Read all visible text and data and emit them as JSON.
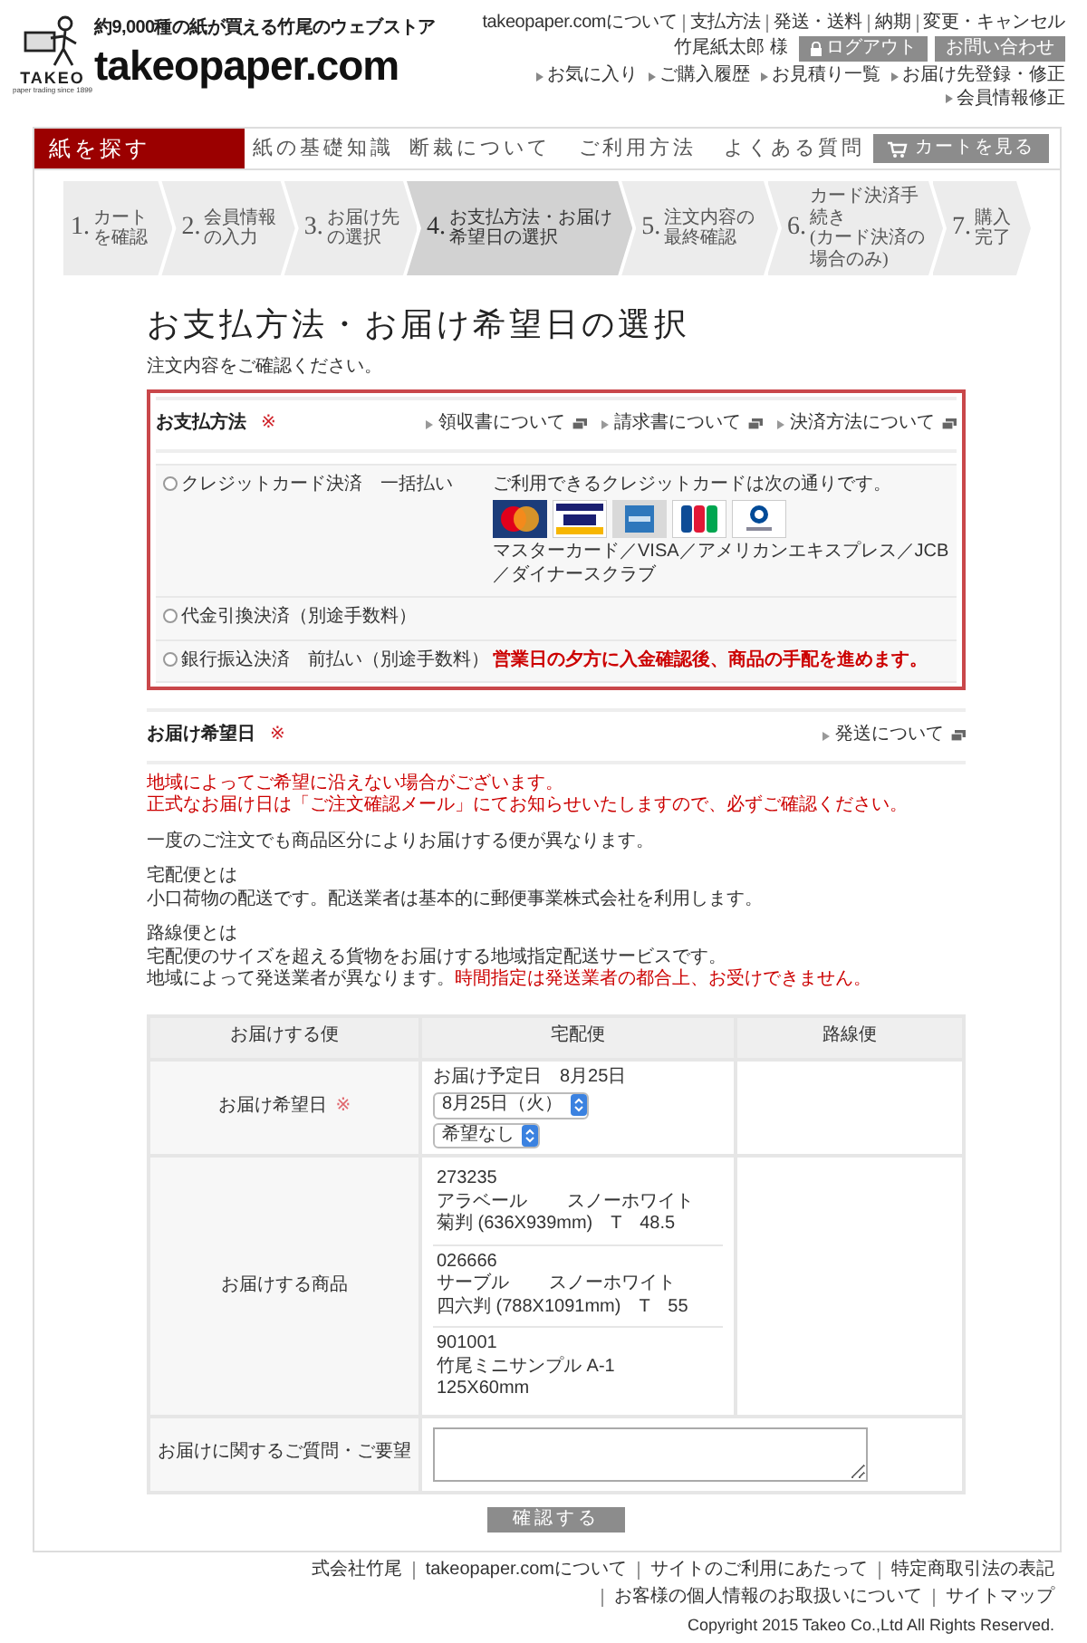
{
  "header": {
    "logo": {
      "name": "TAKEO",
      "tagline": "paper trading since 1899"
    },
    "catchphrase": "約9,000種の紙が買える竹尾のウェブストア",
    "site_title": "takeopaper.com",
    "top_links": [
      "takeopaper.comについて",
      "支払方法",
      "発送・送料",
      "納期",
      "変更・キャンセル"
    ],
    "user_name": "竹尾紙太郎 様",
    "logout_button": "ログアウト",
    "contact_button": "お問い合わせ",
    "account_links": [
      "お気に入り",
      "ご購入履歴",
      "お見積り一覧",
      "お届け先登録・修正",
      "会員情報修正"
    ]
  },
  "nav": {
    "items": [
      {
        "label": "紙を探す",
        "selected": true
      },
      {
        "label": "紙の基礎知識",
        "selected": false
      },
      {
        "label": "断裁について",
        "selected": false
      },
      {
        "label": "ご利用方法",
        "selected": false
      },
      {
        "label": "よくある質問",
        "selected": false
      }
    ],
    "cart_button": "カートを見る"
  },
  "steps": [
    {
      "number": "1.",
      "label": "カートを確認",
      "selected": false
    },
    {
      "number": "2.",
      "label": "会員情報の入力",
      "selected": false
    },
    {
      "number": "3.",
      "label": "お届け先の選択",
      "selected": false
    },
    {
      "number": "4.",
      "label": "お支払方法・お届け希望日の選択",
      "selected": true
    },
    {
      "number": "5.",
      "label": "注文内容の最終確認",
      "selected": false
    },
    {
      "number": "6.",
      "label": "カード決済手続き",
      "sublabel": "(カード決済の場合のみ)",
      "selected": false
    },
    {
      "number": "7.",
      "label": "購入完了",
      "selected": false
    }
  ],
  "title": "お支払方法・お届け希望日の選択",
  "intro": "注文内容をご確認ください。",
  "payment": {
    "heading": "お支払方法",
    "required_mark": "※",
    "links": [
      "領収書について",
      "請求書について",
      "決済方法について"
    ],
    "options": [
      {
        "kind": "cards",
        "label": "クレジットカード決済　一括払い",
        "selected": false,
        "note": "ご利用できるクレジットカードは次の通りです。",
        "cards_caption": "マスターカード／VISA／アメリカンエキスプレス／JCB／ダイナースクラブ"
      },
      {
        "kind": "plain",
        "label": "代金引換決済（別途手数料）",
        "selected": false
      },
      {
        "kind": "notice",
        "label": "銀行振込決済　前払い（別途手数料）",
        "selected": false,
        "note": "営業日の夕方に入金確認後、商品の手配を進めます。"
      }
    ]
  },
  "delivery": {
    "heading": "お届け希望日",
    "required_mark": "※",
    "link": "発送について",
    "notes": [
      {
        "lines": [
          {
            "segments": [
              {
                "text": "地域によってご希望に沿えない場合がございます。",
                "warning": true
              }
            ]
          },
          {
            "segments": [
              {
                "text": "正式なお届け日は「ご注文確認メール」にてお知らせいたしますので、必ずご確認ください。",
                "warning": true
              }
            ]
          }
        ]
      },
      {
        "lines": [
          {
            "segments": [
              {
                "text": "一度のご注文でも商品区分によりお届けする便が異なります。",
                "warning": false
              }
            ]
          }
        ]
      },
      {
        "lines": [
          {
            "segments": [
              {
                "text": "宅配便とは",
                "warning": false
              }
            ]
          },
          {
            "segments": [
              {
                "text": "小口荷物の配送です。配送業者は基本的に郵便事業株式会社を利用します。",
                "warning": false
              }
            ]
          }
        ]
      },
      {
        "lines": [
          {
            "segments": [
              {
                "text": "路線便とは",
                "warning": false
              }
            ]
          },
          {
            "segments": [
              {
                "text": "宅配便のサイズを超える貨物をお届けする地域指定配送サービスです。",
                "warning": false
              }
            ]
          },
          {
            "segments": [
              {
                "text": "地域によって発送業者が異なります。",
                "warning": false
              },
              {
                "text": "時間指定は発送業者の都合上、お受けできません。",
                "warning": true
              }
            ]
          }
        ]
      }
    ],
    "table": {
      "columns": [
        "お届けする便",
        "宅配便",
        "路線便"
      ],
      "date_row": {
        "label": "お届け希望日",
        "required_mark": "※",
        "scheduled": "お届け予定日　8月25日",
        "date_select": "8月25日（火）",
        "time_select": "希望なし"
      },
      "items_row": {
        "label": "お届けする商品",
        "products": [
          {
            "code": "273235",
            "name": "アラベール",
            "paper_color": "スノーホワイト",
            "size": "菊判 (636X939mm)　T　48.5"
          },
          {
            "code": "026666",
            "name": "サーブル",
            "paper_color": "スノーホワイト",
            "size": "四六判 (788X1091mm)　T　55"
          },
          {
            "code": "901001",
            "name": "竹尾ミニサンプル A-1",
            "size": "125X60mm"
          }
        ]
      },
      "request_row": {
        "label": "お届けに関するご質問・ご要望"
      }
    }
  },
  "confirm_button": "確認する",
  "footer": {
    "links": [
      "式会社竹尾",
      "takeopaper.comについて",
      "サイトのご利用にあたって",
      "特定商取引法の表記",
      "お客様の個人情報のお取扱いについて",
      "サイトマップ"
    ],
    "copyright": "Copyright 2015 Takeo Co.,Ltd All Rights Reserved."
  }
}
